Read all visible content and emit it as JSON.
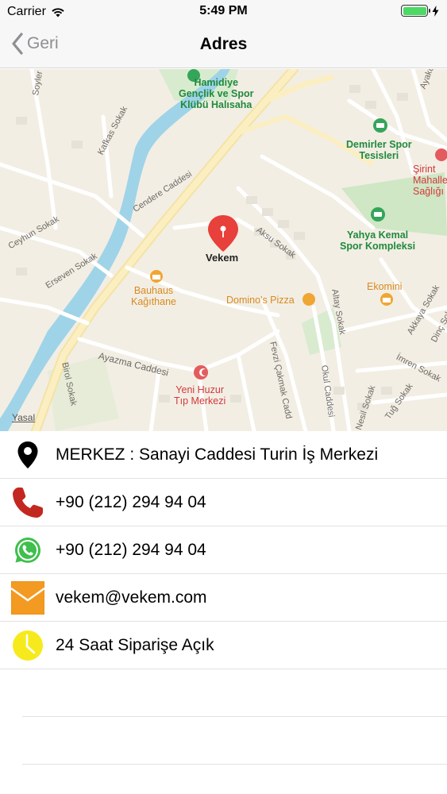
{
  "status_bar": {
    "carrier": "Carrier",
    "time": "5:49 PM",
    "battery_level": 1.0,
    "battery_color": "#4cd964"
  },
  "nav": {
    "back_label": "Geri",
    "title": "Adres"
  },
  "map": {
    "pin_label": "Vekem",
    "pin_color": "#e8403a",
    "legal_label": "Yasal",
    "places": {
      "hamidiye": "Hamidiye\nGençlik ve Spor\nKlübü Halısaha",
      "demirler": "Demirler Spor\nTesisleri",
      "sirinti": "Şirint\nMahalle\nSağlığı M",
      "yahya": "Yahya Kemal\nSpor Kompleksi",
      "ekomini": "Ekomini",
      "bauhaus": "Bauhaus\nKağıthane",
      "dominos": "Domino's Pizza",
      "yeni_huzur": "Yeni Huzur\nTıp Merkezi"
    },
    "streets": {
      "cendere": "Cendere Caddesi",
      "ayazma": "Ayazma Caddesi",
      "fevzi": "Fevzi Çakmak Cadd",
      "okul": "Okul Caddesi",
      "aksu": "Aksu Sokak",
      "altay": "Altay Sokak",
      "kafkas": "Kafkas Sokak",
      "ceyhun": "Ceyhun Sokak",
      "erseven": "Erseven Sokak",
      "birol": "Birol Sokak",
      "soyler": "Soyler",
      "akkaya": "Akkaya Sokak",
      "imren": "İmren Sokak",
      "dinc": "Dinç Sok",
      "tug": "Tuğ Sokak",
      "nesil": "Nesil Sokak",
      "ayakcil": "Ayakcil"
    }
  },
  "contacts": [
    {
      "type": "address",
      "text": "MERKEZ : Sanayi Caddesi Turin İş Merkezi",
      "icon": "location-pin-icon"
    },
    {
      "type": "phone",
      "text": "+90 (212) 294 94 04",
      "icon": "phone-icon"
    },
    {
      "type": "whatsapp",
      "text": "+90 (212) 294 94 04",
      "icon": "whatsapp-icon"
    },
    {
      "type": "email",
      "text": "vekem@vekem.com",
      "icon": "mail-icon"
    },
    {
      "type": "hours",
      "text": "24 Saat Siparişe Açık",
      "icon": "clock-icon"
    }
  ]
}
